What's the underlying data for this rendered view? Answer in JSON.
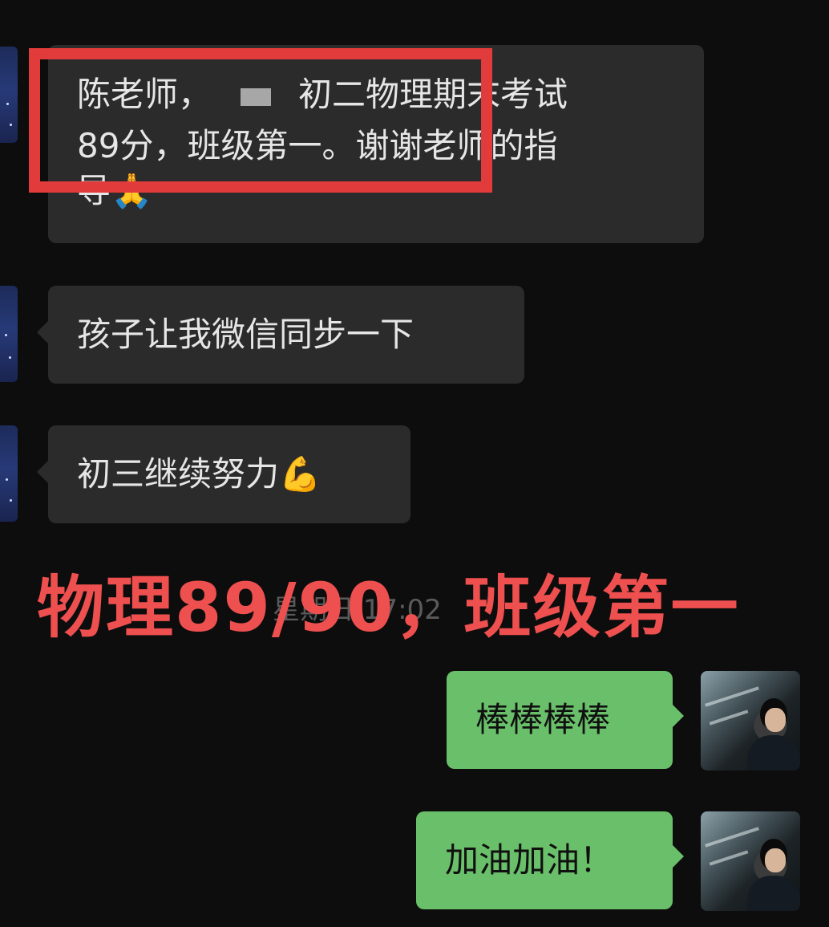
{
  "messages_left": [
    {
      "line1_prefix": "陈老师，",
      "line1_suffix": "初二物理期末考试",
      "line2": "89分，班级第一。谢谢老师的指",
      "line3": "导🙏"
    },
    {
      "text": "孩子让我微信同步一下"
    },
    {
      "text": "初三继续努力💪"
    }
  ],
  "timestamp": "星期日 17:02",
  "overlay_caption": "物理89/90，班级第一",
  "messages_right": [
    {
      "text": "棒棒棒棒"
    },
    {
      "text": "加油加油！"
    }
  ],
  "colors": {
    "highlight_box": "#e23b3b",
    "overlay_text": "#ee4f4f",
    "sent_bubble": "#6ac06a",
    "received_bubble": "#2b2b2b"
  }
}
